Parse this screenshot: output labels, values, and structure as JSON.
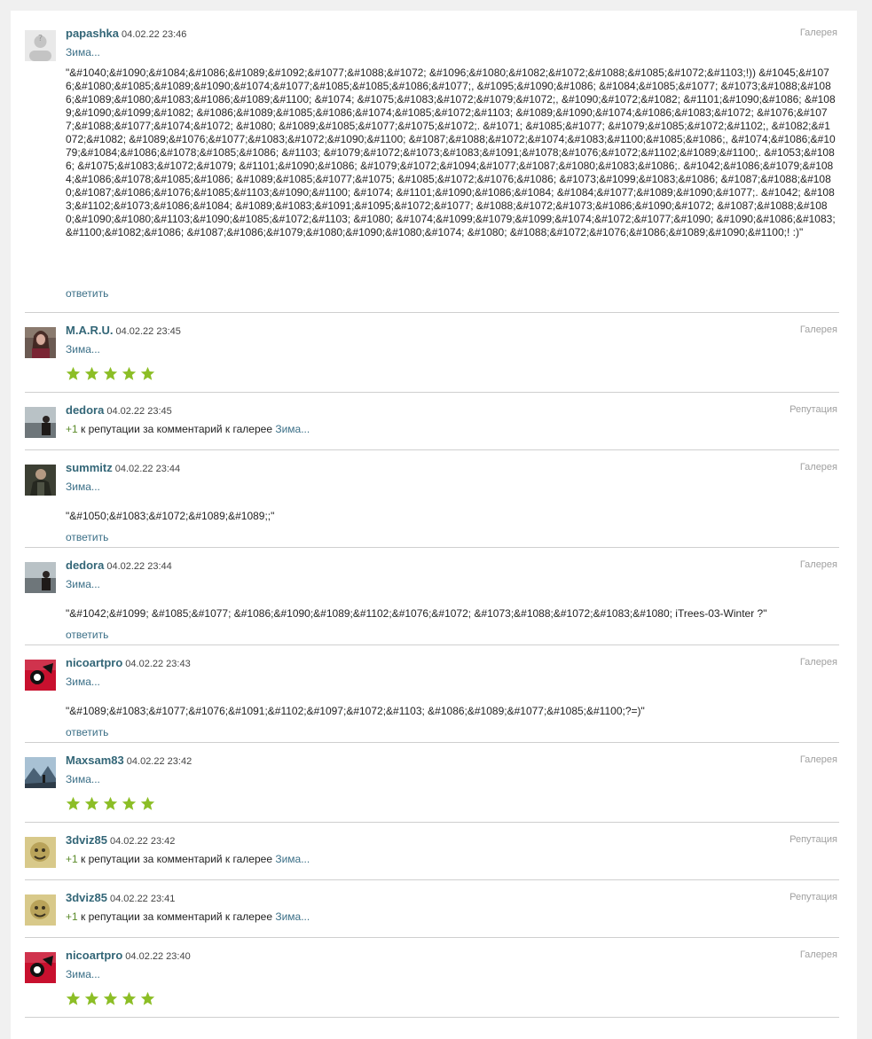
{
  "colors": {
    "accent": "#3b6f87",
    "star": "#8cbe26",
    "plus": "#5b8b2a"
  },
  "comments": [
    {
      "user": "papashka",
      "date": "04.02.22 23:46",
      "type": "Галерея",
      "target": "Зима...",
      "avatar": "placeholder-avatar",
      "text": "\"&#1040;&#1090;&#1084;&#1086;&#1089;&#1092;&#1077;&#1088;&#1072; &#1096;&#1080;&#1082;&#1072;&#1088;&#1085;&#1072;&#1103;!)) &#1045;&#1076;&#1080;&#1085;&#1089;&#1090;&#1074;&#1077;&#1085;&#1085;&#1086;&#1077;, &#1095;&#1090;&#1086; &#1084;&#1085;&#1077; &#1073;&#1088;&#1086;&#1089;&#1080;&#1083;&#1086;&#1089;&#1100; &#1074; &#1075;&#1083;&#1072;&#1079;&#1072;, &#1090;&#1072;&#1082; &#1101;&#1090;&#1086; &#1089;&#1090;&#1099;&#1082; &#1086;&#1089;&#1085;&#1086;&#1074;&#1085;&#1072;&#1103; &#1089;&#1090;&#1074;&#1086;&#1083;&#1072; &#1076;&#1077;&#1088;&#1077;&#1074;&#1072; &#1080; &#1089;&#1085;&#1077;&#1075;&#1072;. &#1071; &#1085;&#1077; &#1079;&#1085;&#1072;&#1102;, &#1082;&#1072;&#1082; &#1089;&#1076;&#1077;&#1083;&#1072;&#1090;&#1100; &#1087;&#1088;&#1072;&#1074;&#1083;&#1100;&#1085;&#1086;, &#1074;&#1086;&#1079;&#1084;&#1086;&#1078;&#1085;&#1086; &#1103; &#1079;&#1072;&#1073;&#1083;&#1091;&#1078;&#1076;&#1072;&#1102;&#1089;&#1100;. &#1053;&#1086; &#1075;&#1083;&#1072;&#1079; &#1101;&#1090;&#1086; &#1079;&#1072;&#1094;&#1077;&#1087;&#1080;&#1083;&#1086;. &#1042;&#1086;&#1079;&#1084;&#1086;&#1078;&#1085;&#1086; &#1089;&#1085;&#1077;&#1075; &#1085;&#1072;&#1076;&#1086; &#1073;&#1099;&#1083;&#1086; &#1087;&#1088;&#1080;&#1087;&#1086;&#1076;&#1085;&#1103;&#1090;&#1100; &#1074; &#1101;&#1090;&#1086;&#1084; &#1084;&#1077;&#1089;&#1090;&#1077;. &#1042; &#1083;&#1102;&#1073;&#1086;&#1084; &#1089;&#1083;&#1091;&#1095;&#1072;&#1077; &#1088;&#1072;&#1073;&#1086;&#1090;&#1072; &#1087;&#1088;&#1080;&#1090;&#1080;&#1103;&#1090;&#1085;&#1072;&#1103; &#1080; &#1074;&#1099;&#1079;&#1099;&#1074;&#1072;&#1077;&#1090; &#1090;&#1086;&#1083;&#1100;&#1082;&#1086; &#1087;&#1086;&#1079;&#1080;&#1090;&#1080;&#1074; &#1080; &#1088;&#1072;&#1076;&#1086;&#1089;&#1090;&#1100;! :)\"",
      "reply": "ответить"
    },
    {
      "user": "M.A.R.U.",
      "date": "04.02.22 23:45",
      "type": "Галерея",
      "target": "Зима...",
      "avatar": "woman-portrait-avatar",
      "rating": 5
    },
    {
      "user": "dedora",
      "date": "04.02.22 23:45",
      "type": "Репутация",
      "avatar": "seaside-person-avatar",
      "plus": "+1",
      "rep_text": "к репутации за комментарий к галерее",
      "target": "Зима..."
    },
    {
      "user": "summitz",
      "date": "04.02.22 23:44",
      "type": "Галерея",
      "target": "Зима...",
      "avatar": "dark-figure-avatar",
      "text": "\"&#1050;&#1083;&#1072;&#1089;&#1089;;\"",
      "reply": "ответить"
    },
    {
      "user": "dedora",
      "date": "04.02.22 23:44",
      "type": "Галерея",
      "target": "Зима...",
      "avatar": "seaside-person-avatar",
      "text": "\"&#1042;&#1099; &#1085;&#1077; &#1086;&#1090;&#1089;&#1102;&#1076;&#1072; &#1073;&#1088;&#1072;&#1083;&#1080; iTrees-03-Winter ?\"",
      "reply": "ответить"
    },
    {
      "user": "nicoartpro",
      "date": "04.02.22 23:43",
      "type": "Галерея",
      "target": "Зима...",
      "avatar": "red-logo-avatar",
      "text": "\"&#1089;&#1083;&#1077;&#1076;&#1091;&#1102;&#1097;&#1072;&#1103; &#1086;&#1089;&#1077;&#1085;&#1100;?=)\"",
      "reply": "ответить"
    },
    {
      "user": "Maxsam83",
      "date": "04.02.22 23:42",
      "type": "Галерея",
      "target": "Зима...",
      "avatar": "mountain-avatar",
      "rating": 5
    },
    {
      "user": "3dviz85",
      "date": "04.02.22 23:42",
      "type": "Репутация",
      "avatar": "yellow-face-avatar",
      "plus": "+1",
      "rep_text": "к репутации за комментарий к галерее",
      "target": "Зима..."
    },
    {
      "user": "3dviz85",
      "date": "04.02.22 23:41",
      "type": "Репутация",
      "avatar": "yellow-face-avatar",
      "plus": "+1",
      "rep_text": "к репутации за комментарий к галерее",
      "target": "Зима..."
    },
    {
      "user": "nicoartpro",
      "date": "04.02.22 23:40",
      "type": "Галерея",
      "target": "Зима...",
      "avatar": "red-logo-avatar",
      "rating": 5
    }
  ]
}
